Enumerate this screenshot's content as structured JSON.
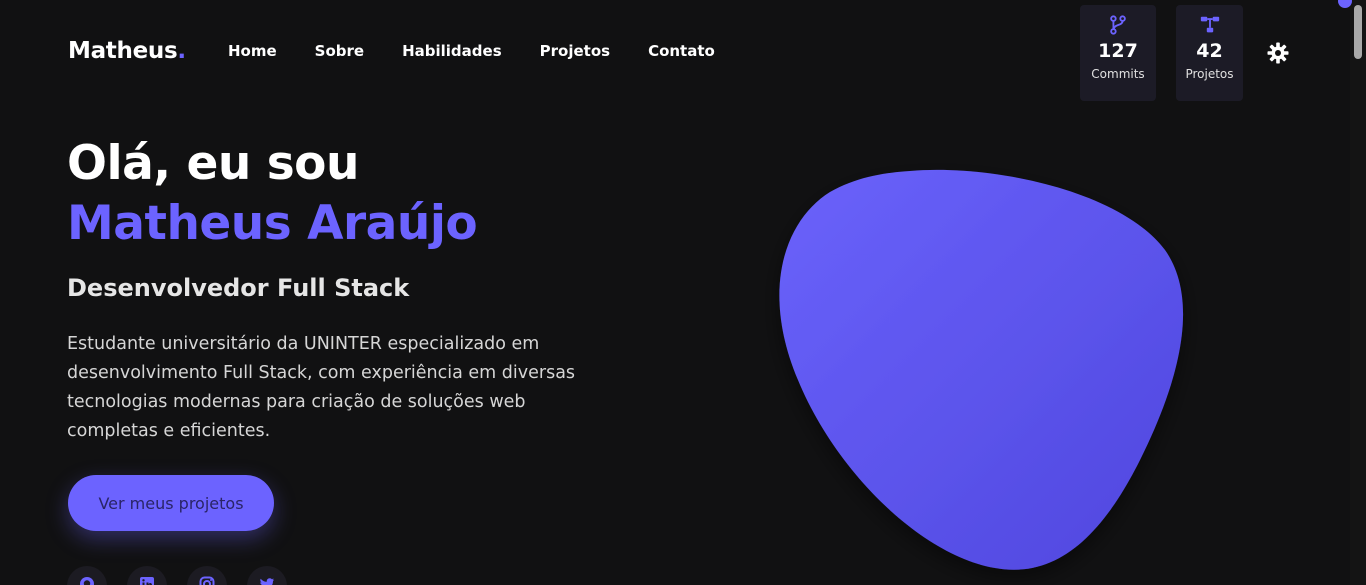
{
  "header": {
    "logo": "Matheus",
    "logo_dot": ".",
    "nav": [
      {
        "label": "Home"
      },
      {
        "label": "Sobre"
      },
      {
        "label": "Habilidades"
      },
      {
        "label": "Projetos"
      },
      {
        "label": "Contato"
      }
    ],
    "stats": [
      {
        "icon": "git-branch-icon",
        "value": "127",
        "label": "Commits"
      },
      {
        "icon": "project-tree-icon",
        "value": "42",
        "label": "Projetos"
      }
    ],
    "theme_toggle_icon": "gear-icon"
  },
  "hero": {
    "greeting": "Olá, eu sou",
    "name": "Matheus Araújo",
    "role": "Desenvolvedor Full Stack",
    "description": "Estudante universitário da UNINTER especializado em desenvolvimento Full Stack, com experiência em diversas tecnologias modernas para criação de soluções web completas e eficientes.",
    "cta_label": "Ver meus projetos",
    "socials": [
      {
        "icon": "github-icon"
      },
      {
        "icon": "linkedin-icon"
      },
      {
        "icon": "instagram-icon"
      },
      {
        "icon": "twitter-icon"
      }
    ]
  },
  "colors": {
    "accent": "#6c63ff",
    "background": "#111112",
    "card": "#1c1b26"
  }
}
